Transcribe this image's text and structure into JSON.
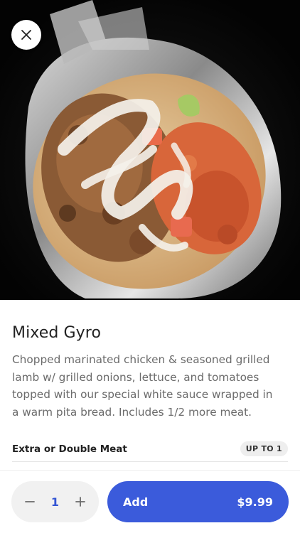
{
  "item": {
    "title": "Mixed Gyro",
    "description": "Chopped marinated chicken & seasoned grilled lamb w/ grilled onions, lettuce, and tomatoes topped with our special white sauce wrapped in a warm pita bread. Includes 1/2 more meat."
  },
  "options": [
    {
      "label": "Extra or Double Meat",
      "badge": "UP TO 1"
    }
  ],
  "cart": {
    "quantity": "1",
    "add_label": "Add",
    "price": "$9.99"
  },
  "icons": {
    "close": "close-icon",
    "minus": "minus-icon",
    "plus": "plus-icon"
  },
  "colors": {
    "accent": "#3b5bdb",
    "quantity_text": "#3456d4"
  }
}
